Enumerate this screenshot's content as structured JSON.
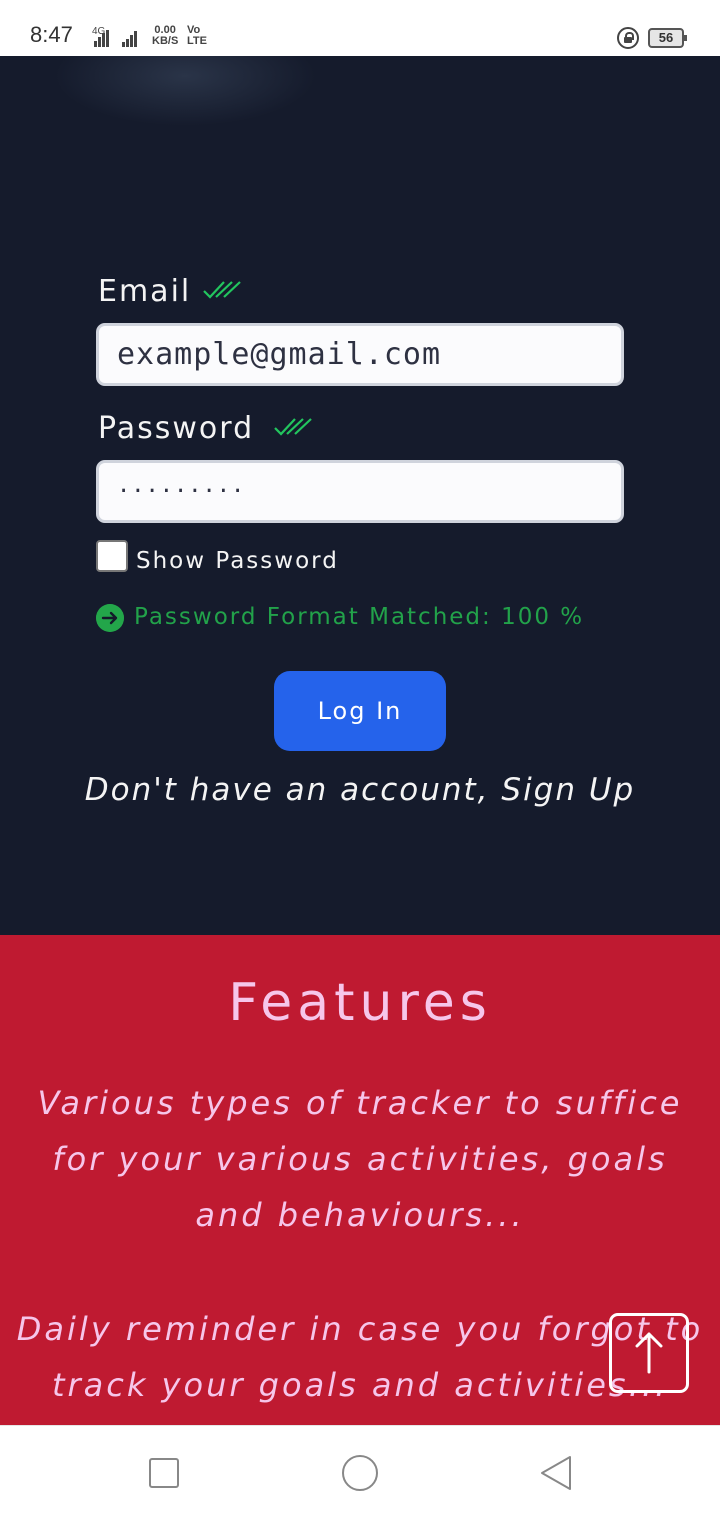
{
  "status_bar": {
    "time": "8:47",
    "network": "4G",
    "speed_value": "0.00",
    "speed_unit": "KB/S",
    "volte_top": "Vo",
    "volte_bottom": "LTE",
    "battery": "56"
  },
  "login": {
    "email_label": "Email",
    "email_value": "example@gmail.com",
    "password_label": "Password",
    "password_value": "·········",
    "show_password_label": "Show Password",
    "show_password_checked": false,
    "format_status": "Password Format Matched: 100 %",
    "login_button": "Log In",
    "signup_text": "Don't have an account, Sign Up",
    "check_color": "#22c55e",
    "accent_color": "#2563eb",
    "status_color": "#22a24a"
  },
  "features": {
    "title": "Features",
    "items": [
      "Various types of tracker to suffice for your various activities, goals and behaviours...",
      "Daily reminder in case you forgot to track your goals and activities..."
    ],
    "background_color": "#bf1a31",
    "text_color": "#f6c6ea"
  },
  "icons": {
    "scroll_top": "arrow-up-icon",
    "format_status": "arrow-right-circle-icon",
    "validation": "double-check-icon"
  },
  "nav_bar": {
    "recent": "square-icon",
    "home": "circle-icon",
    "back": "triangle-back-icon"
  }
}
